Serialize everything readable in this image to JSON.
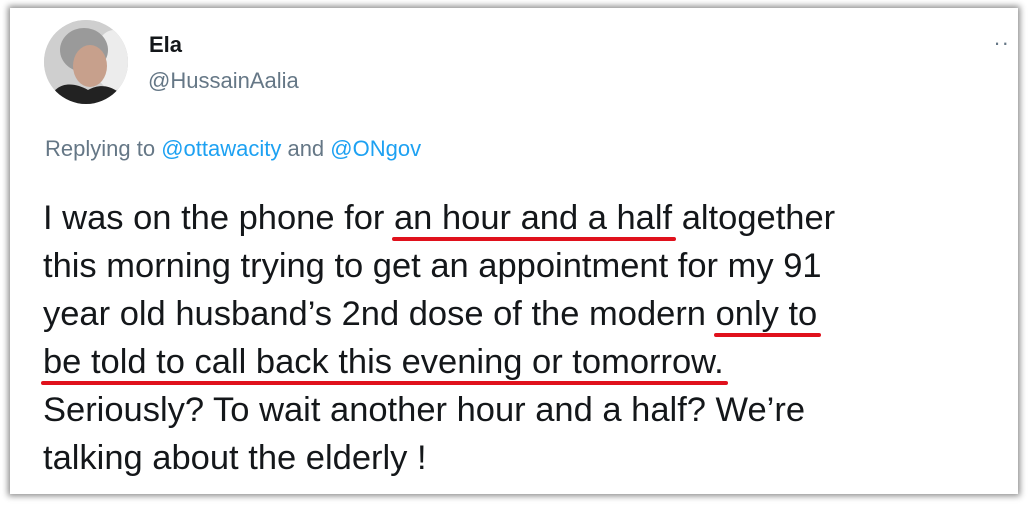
{
  "tweet": {
    "author_name": "Ela",
    "author_handle": "@HussainAalia",
    "more_icon": "ellipsis-icon",
    "replying_prefix": "Replying to ",
    "reply_handle_1": "@ottawacity",
    "reply_and": " and ",
    "reply_handle_2": "@ONgov",
    "body": {
      "l1a": "I was on the phone for ",
      "l1b": "an hour and a half",
      "l1c": " altogether",
      "l2": "this morning trying to get an appointment for my 91",
      "l3a": "year old husband’s 2nd dose of the modern ",
      "l3b": "only to",
      "l4": "be told to call back this evening or tomorrow.",
      "l5": "Seriously? To wait another hour and a half? We’re",
      "l6": "talking about the elderly !"
    },
    "annotation_color": "#e0111c"
  }
}
